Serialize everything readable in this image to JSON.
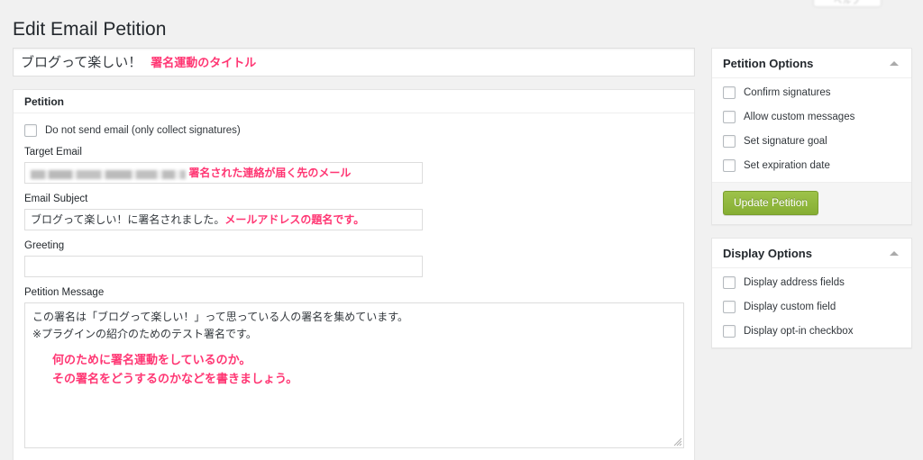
{
  "page": {
    "title": "Edit Email Petition",
    "background_color": "#f1f1f1",
    "annotation_color": "#ff3673",
    "accent_button_color": "#90b73f"
  },
  "screen_tab": {
    "label": "ヘルプ"
  },
  "post_title": {
    "value": "ブログって楽しい！",
    "annotation": "署名運動のタイトル"
  },
  "petition_box": {
    "header": "Petition",
    "no_email_checkbox": {
      "label": "Do not send email (only collect signatures)",
      "checked": false
    },
    "fields": [
      {
        "label": "Target Email",
        "value": "",
        "redacted": true,
        "annotation": "署名された連絡が届く先のメール"
      },
      {
        "label": "Email Subject",
        "value": "ブログって楽しい！に署名されました。",
        "redacted": false,
        "annotation": "メールアドレスの題名です。"
      },
      {
        "label": "Greeting",
        "value": "",
        "redacted": false,
        "annotation": ""
      }
    ],
    "message": {
      "label": "Petition Message",
      "lines": [
        "この署名は「ブログって楽しい！」って思っている人の署名を集めています。",
        "※プラグインの紹介のためのテスト署名です。"
      ],
      "annotation_lines": [
        "何のために署名運動をしているのか。",
        "その署名をどうするのかなどを書きましょう。"
      ]
    }
  },
  "sidebar": {
    "petition_options": {
      "header": "Petition Options",
      "toggle_icon": "caret-up-icon",
      "checkboxes": [
        {
          "label": "Confirm signatures",
          "checked": false
        },
        {
          "label": "Allow custom messages",
          "checked": false
        },
        {
          "label": "Set signature goal",
          "checked": false
        },
        {
          "label": "Set expiration date",
          "checked": false
        }
      ],
      "submit_label": "Update Petition"
    },
    "display_options": {
      "header": "Display Options",
      "toggle_icon": "caret-up-icon",
      "checkboxes": [
        {
          "label": "Display address fields",
          "checked": false
        },
        {
          "label": "Display custom field",
          "checked": false
        },
        {
          "label": "Display opt-in checkbox",
          "checked": false
        }
      ]
    }
  }
}
